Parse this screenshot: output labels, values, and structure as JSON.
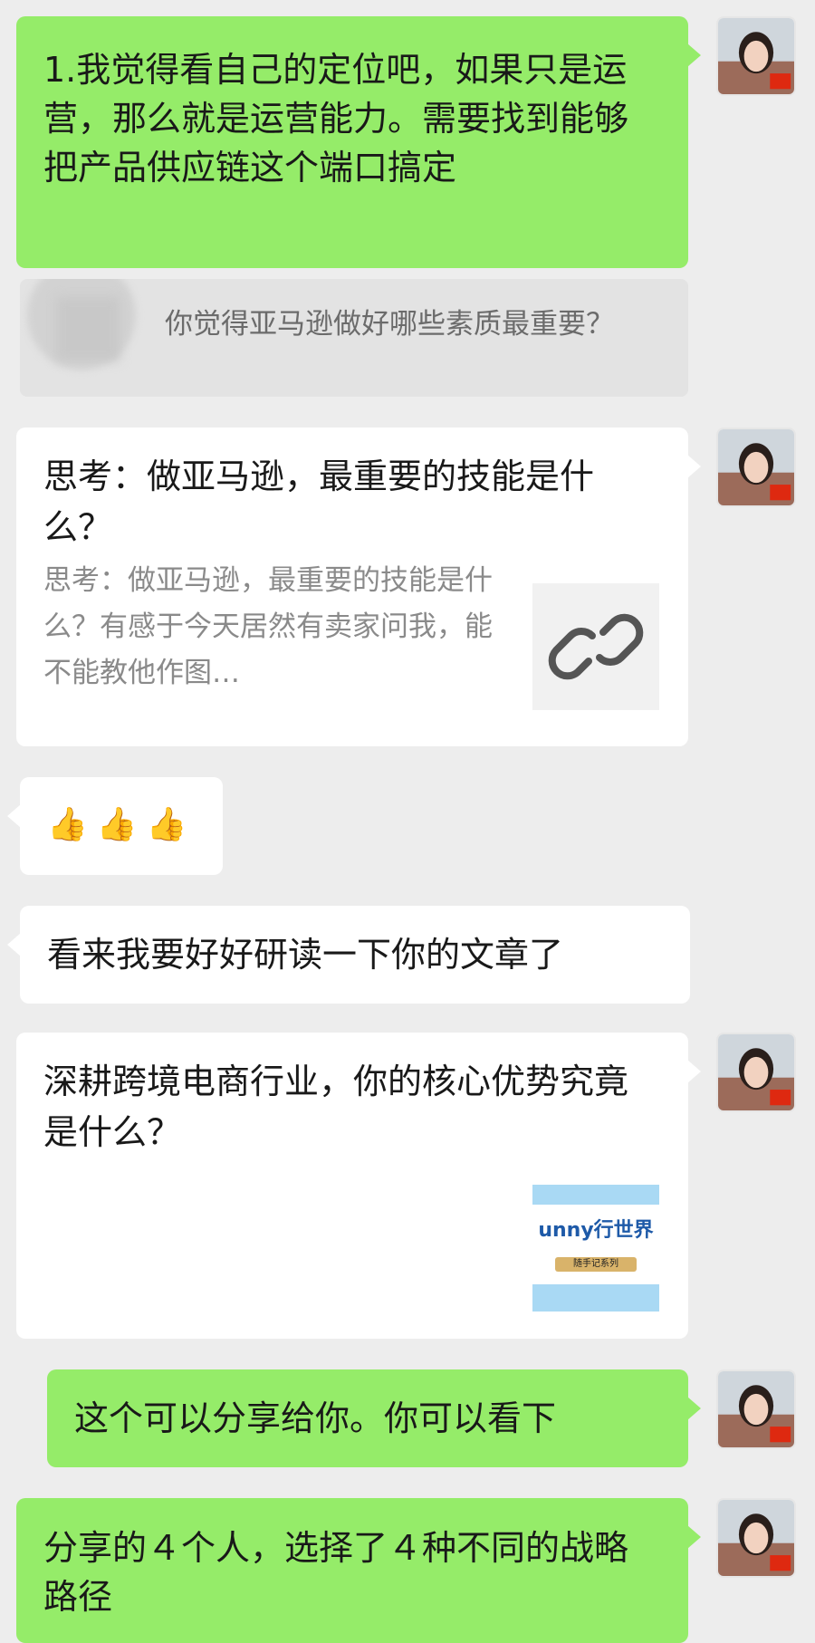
{
  "messages": {
    "m1": {
      "text": "1.我觉得看自己的定位吧，如果只是运营，那么就是运营能力。需要找到能够把产品供应链这个端口搞定"
    },
    "quote": {
      "text": "你觉得亚马逊做好哪些素质最重要？"
    },
    "card1": {
      "title": "思考：做亚马逊，最重要的技能是什么？",
      "desc": "思考：做亚马逊，最重要的技能是什么？有感于今天居然有卖家问我，能不能教他作图…",
      "icon": "link-icon"
    },
    "m3": {
      "emoji": [
        "👍",
        "👍",
        "👍"
      ]
    },
    "m4": {
      "text": "看来我要好好研读一下你的文章了"
    },
    "card2": {
      "title": "深耕跨境电商行业，你的核心优势究竟是什么？",
      "thumb_text": "unny行世界",
      "thumb_sub": "随手记系列"
    },
    "m5": {
      "text": "这个可以分享给你。你可以看下"
    },
    "m6": {
      "text": "分享的４个人，选择了４种不同的战略路径"
    }
  },
  "colors": {
    "sent_bubble": "#95ec69",
    "received_bubble": "#ffffff",
    "background": "#ededed"
  },
  "avatar": {
    "flag": "🇨🇳"
  }
}
